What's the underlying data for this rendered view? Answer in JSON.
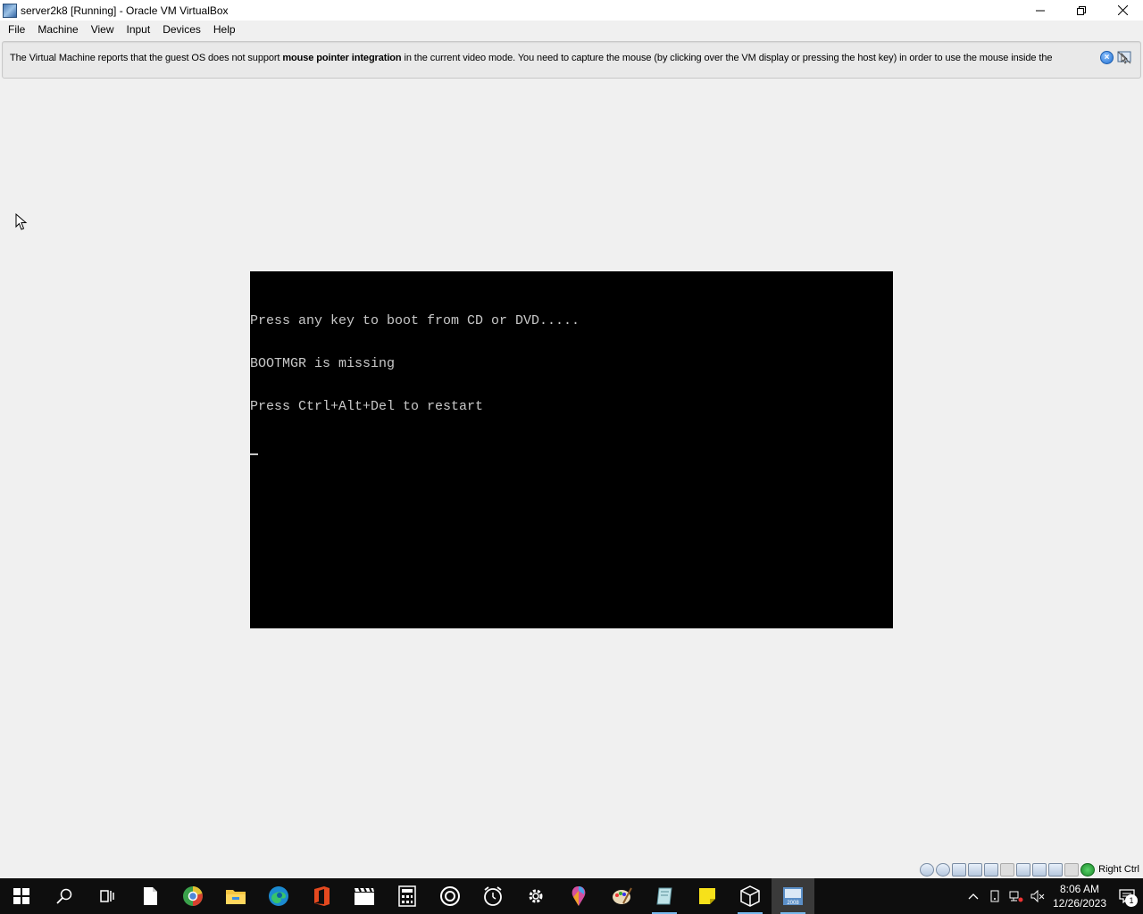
{
  "window": {
    "title": "server2k8 [Running] - Oracle VM VirtualBox"
  },
  "menu": {
    "items": [
      "File",
      "Machine",
      "View",
      "Input",
      "Devices",
      "Help"
    ]
  },
  "banner": {
    "text_before": "The Virtual Machine reports that the guest OS does not support ",
    "text_bold": "mouse pointer integration",
    "text_after": " in the current video mode. You need to capture the mouse (by clicking over the VM display or pressing the host key) in order to use the mouse inside the"
  },
  "console": {
    "lines": [
      "Press any key to boot from CD or DVD.....",
      "BOOTMGR is missing",
      "Press Ctrl+Alt+Del to restart"
    ]
  },
  "statusbar": {
    "host_key_label": "Right Ctrl"
  },
  "taskbar": {
    "apps": [
      "start-icon",
      "search-icon",
      "task-view-icon",
      "notepad-icon",
      "browser-icon",
      "file-explorer-icon",
      "edge-icon",
      "office-icon",
      "video-editor-icon",
      "calculator-icon",
      "media-player-icon",
      "alarms-icon",
      "settings-icon",
      "paint3d-icon",
      "paint-icon",
      "app-icon",
      "sticky-notes-icon",
      "virtualbox-icon",
      "server2008-vm-icon"
    ]
  },
  "clock": {
    "time": "8:06 AM",
    "date": "12/26/2023"
  },
  "notifications": {
    "count": "1"
  },
  "colors": {
    "taskbar_bg": "#0e0e0e",
    "vm_screen_bg": "#000000",
    "console_text": "#c8c8c8",
    "window_bg": "#f0f0f0",
    "taskbar_indicator": "#76b9ed"
  }
}
